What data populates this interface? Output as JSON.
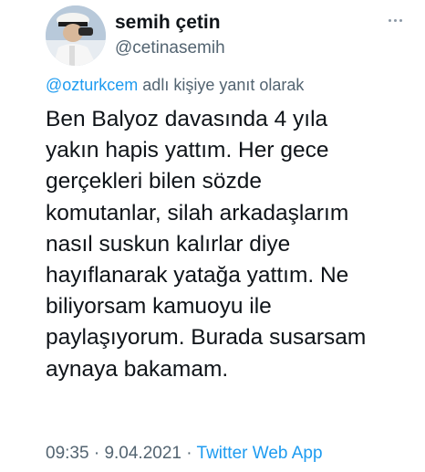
{
  "author": {
    "display_name": "semih çetin",
    "handle": "@cetinasemih"
  },
  "reply_context": {
    "mention": "@ozturkcem",
    "suffix": " adlı kişiye yanıt olarak"
  },
  "tweet": {
    "lines": [
      "Ben Balyoz davasında 4 yıla",
      "yakın hapis yattım. Her gece",
      "gerçekleri bilen sözde",
      "komutanlar, silah arkadaşlarım",
      "nasıl suskun kalırlar diye",
      "hayıflanarak yatağa yattım. Ne",
      "biliyorsam kamuoyu ile",
      "paylaşıyorum. Burada susarsam",
      "aynaya bakamam."
    ]
  },
  "meta": {
    "time": "09:35",
    "separator": " · ",
    "date": "9.04.2021",
    "app": "Twitter Web App"
  },
  "icons": {
    "more": "more-dots-icon"
  },
  "colors": {
    "link": "#1d9bf0",
    "secondary_text": "#536471",
    "primary_text": "#0f1419"
  }
}
